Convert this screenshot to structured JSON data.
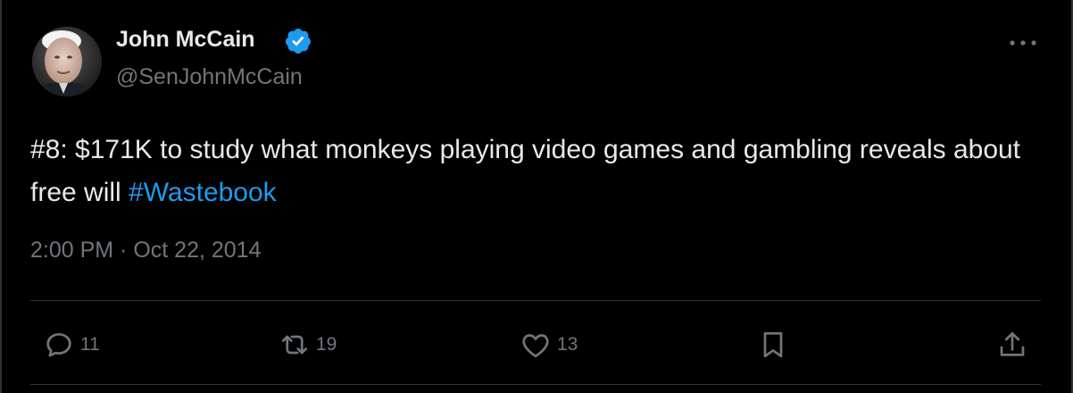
{
  "tweet": {
    "author_name": "John McCain",
    "author_handle": "@SenJohnMcCain",
    "verified": true,
    "text_main": "#8: $171K to study what monkeys playing video games and gambling reveals about free will ",
    "hashtag": "#Wastebook",
    "time": "2:00 PM",
    "separator": " · ",
    "date": "Oct 22, 2014"
  },
  "actions": {
    "replies": "11",
    "retweets": "19",
    "likes": "13"
  },
  "icons": {
    "verified": "verified-badge-icon",
    "more": "more-options-icon",
    "reply": "reply-icon",
    "retweet": "retweet-icon",
    "like": "heart-icon",
    "bookmark": "bookmark-icon",
    "share": "share-icon"
  },
  "colors": {
    "background": "#000000",
    "text": "#e7e9ea",
    "muted": "#71767b",
    "accent": "#1d9bf0",
    "divider": "#2f3336"
  }
}
